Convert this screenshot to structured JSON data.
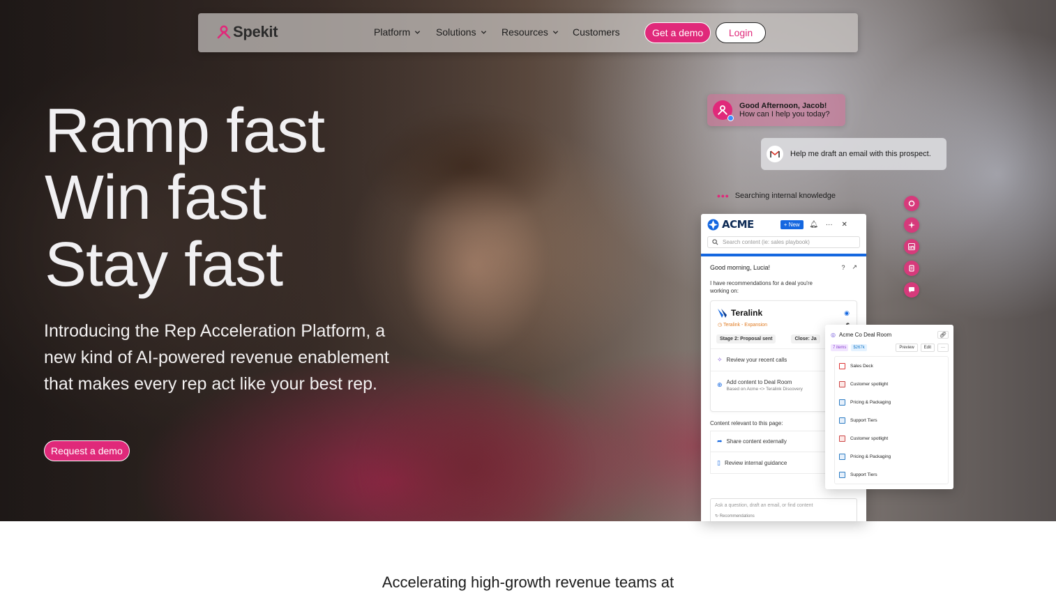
{
  "nav": {
    "logo_text": "Spekit",
    "items": [
      {
        "label": "Platform",
        "has_dropdown": true
      },
      {
        "label": "Solutions",
        "has_dropdown": true
      },
      {
        "label": "Resources",
        "has_dropdown": true
      },
      {
        "label": "Customers",
        "has_dropdown": false
      }
    ],
    "demo_label": "Get a demo",
    "login_label": "Login"
  },
  "hero": {
    "headline": [
      "Ramp fast",
      "Win fast",
      "Stay fast"
    ],
    "subtext": "Introducing the Rep Acceleration Platform, a new kind of AI-powered revenue enablement that makes every rep act like your best rep.",
    "cta_label": "Request a demo"
  },
  "assistant": {
    "greeting_title": "Good Afternoon, Jacob!",
    "greeting_sub": "How can I help you today?",
    "user_request": "Help me draft an email with this prospect.",
    "status": "Searching internal knowledge",
    "side_icons": [
      "spekit-icon",
      "ai-sparkle-icon",
      "linkedin-icon",
      "document-icon",
      "chat-icon"
    ]
  },
  "acme_panel": {
    "brand": "ACME",
    "new_label": "+ New",
    "search_placeholder": "Search content (ie: sales playbook)",
    "greeting": "Good morning, Lucia!",
    "rec_text": "I have recommendations for a deal you're working on:",
    "deal": {
      "name": "Teralink",
      "tag": "Teralink - Expansion",
      "amount_prefix": "$",
      "stage": "Stage 2: Proposal sent",
      "close": "Close: Ja",
      "actions": [
        {
          "label": "Review your recent calls",
          "sub": ""
        },
        {
          "label": "Add content to Deal Room",
          "sub": "Based on  Acme <> Teralink Discovery"
        }
      ]
    },
    "relevant_title": "Content relevant to this page:",
    "relevant": [
      "Share content externally",
      "Review internal guidance"
    ],
    "ask_placeholder": "Ask a question, draft an email, or find content",
    "recommendations_label": "Recommendations"
  },
  "deal_room": {
    "title": "Acme Co Deal Room",
    "items_count": "7 items",
    "value": "$267k",
    "preview_label": "Preview",
    "edit_label": "Edit",
    "more_label": "···",
    "files": [
      {
        "name": "Sales Deck",
        "type": "pdf"
      },
      {
        "name": "Customer spotlight",
        "type": "ppt"
      },
      {
        "name": "Pricing & Packaging",
        "type": "sheet"
      },
      {
        "name": "Support Tiers",
        "type": "sheet"
      },
      {
        "name": "Customer spotlight",
        "type": "ppt"
      },
      {
        "name": "Pricing & Packaging",
        "type": "sheet"
      },
      {
        "name": "Support Tiers",
        "type": "sheet"
      }
    ]
  },
  "below_fold": {
    "heading": "Accelerating high-growth revenue teams at"
  },
  "colors": {
    "brand_pink": "#e0297a",
    "acme_blue": "#1467e0"
  }
}
